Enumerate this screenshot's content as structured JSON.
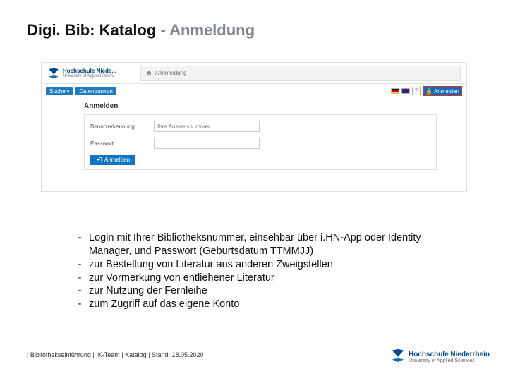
{
  "title": {
    "main": "Digi. Bib: Katalog",
    "separator": " - ",
    "sub": "Anmeldung"
  },
  "screenshot": {
    "logo": {
      "line1": "Hochschule Niede...",
      "line2": "University of Applied Scien..."
    },
    "breadcrumb": {
      "home_icon": "home-icon",
      "text": "/  Anmeldung"
    },
    "tabs": {
      "search": "Suche",
      "databases": "Datenbanken"
    },
    "controls": {
      "flag_de": "de",
      "flag_uk": "uk",
      "help": "?",
      "login": "Anmelden"
    },
    "panel": {
      "title": "Anmelden",
      "fields": {
        "user_label": "Benutzerkennung:",
        "user_placeholder": "Ihre Ausweisnummer",
        "pass_label": "Passwort:"
      },
      "submit": "Anmelden"
    }
  },
  "bullets": [
    "Login mit Ihrer Bibliotheksnummer, einsehbar über i.HN-App oder Identity Manager, und Passwort (Geburtsdatum TTMMJJ)",
    " zur Bestellung von Literatur aus anderen Zweigstellen",
    "zur Vormerkung von entliehener Literatur",
    "zur Nutzung der Fernleihe",
    "zum Zugriff auf das eigene Konto"
  ],
  "footer_line": "| Bibliothekseinführung | IK-Team | Katalog | Stand: 18.05.2020",
  "footer_logo": {
    "line1": "Hochschule Niederrhein",
    "line2": "University of Applied Sciences"
  }
}
